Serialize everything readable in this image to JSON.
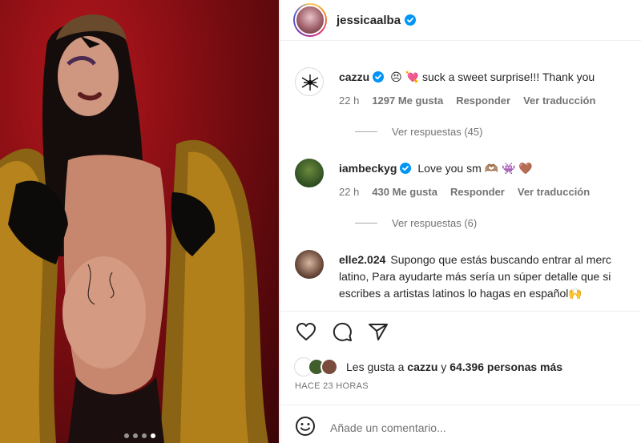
{
  "post": {
    "username": "jessicaalba",
    "carousel": {
      "count": 4,
      "active_index": 3
    }
  },
  "comments": [
    {
      "username": "cazzu",
      "verified": true,
      "text_emoji": "😣 💘",
      "text": "suck a sweet surprise!!! Thank you",
      "age": "22 h",
      "likes": "1297 Me gusta",
      "reply": "Responder",
      "translate": "Ver traducción",
      "view_replies": "Ver respuestas (45)"
    },
    {
      "username": "iambeckyg",
      "verified": true,
      "text": "Love you sm",
      "text_emoji": "🫶🏽 👾 🤎",
      "age": "22 h",
      "likes": "430 Me gusta",
      "reply": "Responder",
      "translate": "Ver traducción",
      "view_replies": "Ver respuestas (6)"
    },
    {
      "username": "elle2.024",
      "verified": false,
      "text_line1": "Supongo que estás buscando entrar al merc",
      "text_line2": "latino, Para ayudarte más sería un súper detalle que si",
      "text_line3": "escribes a artistas latinos lo hagas en español🙌"
    }
  ],
  "likes_summary": {
    "prefix": "Les gusta a",
    "user": "cazzu",
    "middle": "y",
    "count": "64.396 personas más"
  },
  "timestamp": "HACE 23 HORAS",
  "add_comment": {
    "placeholder": "Añade un comentario..."
  },
  "colors": {
    "verified": "#0095f6",
    "meta": "#737373",
    "photo_bg": "#7d0d12"
  }
}
